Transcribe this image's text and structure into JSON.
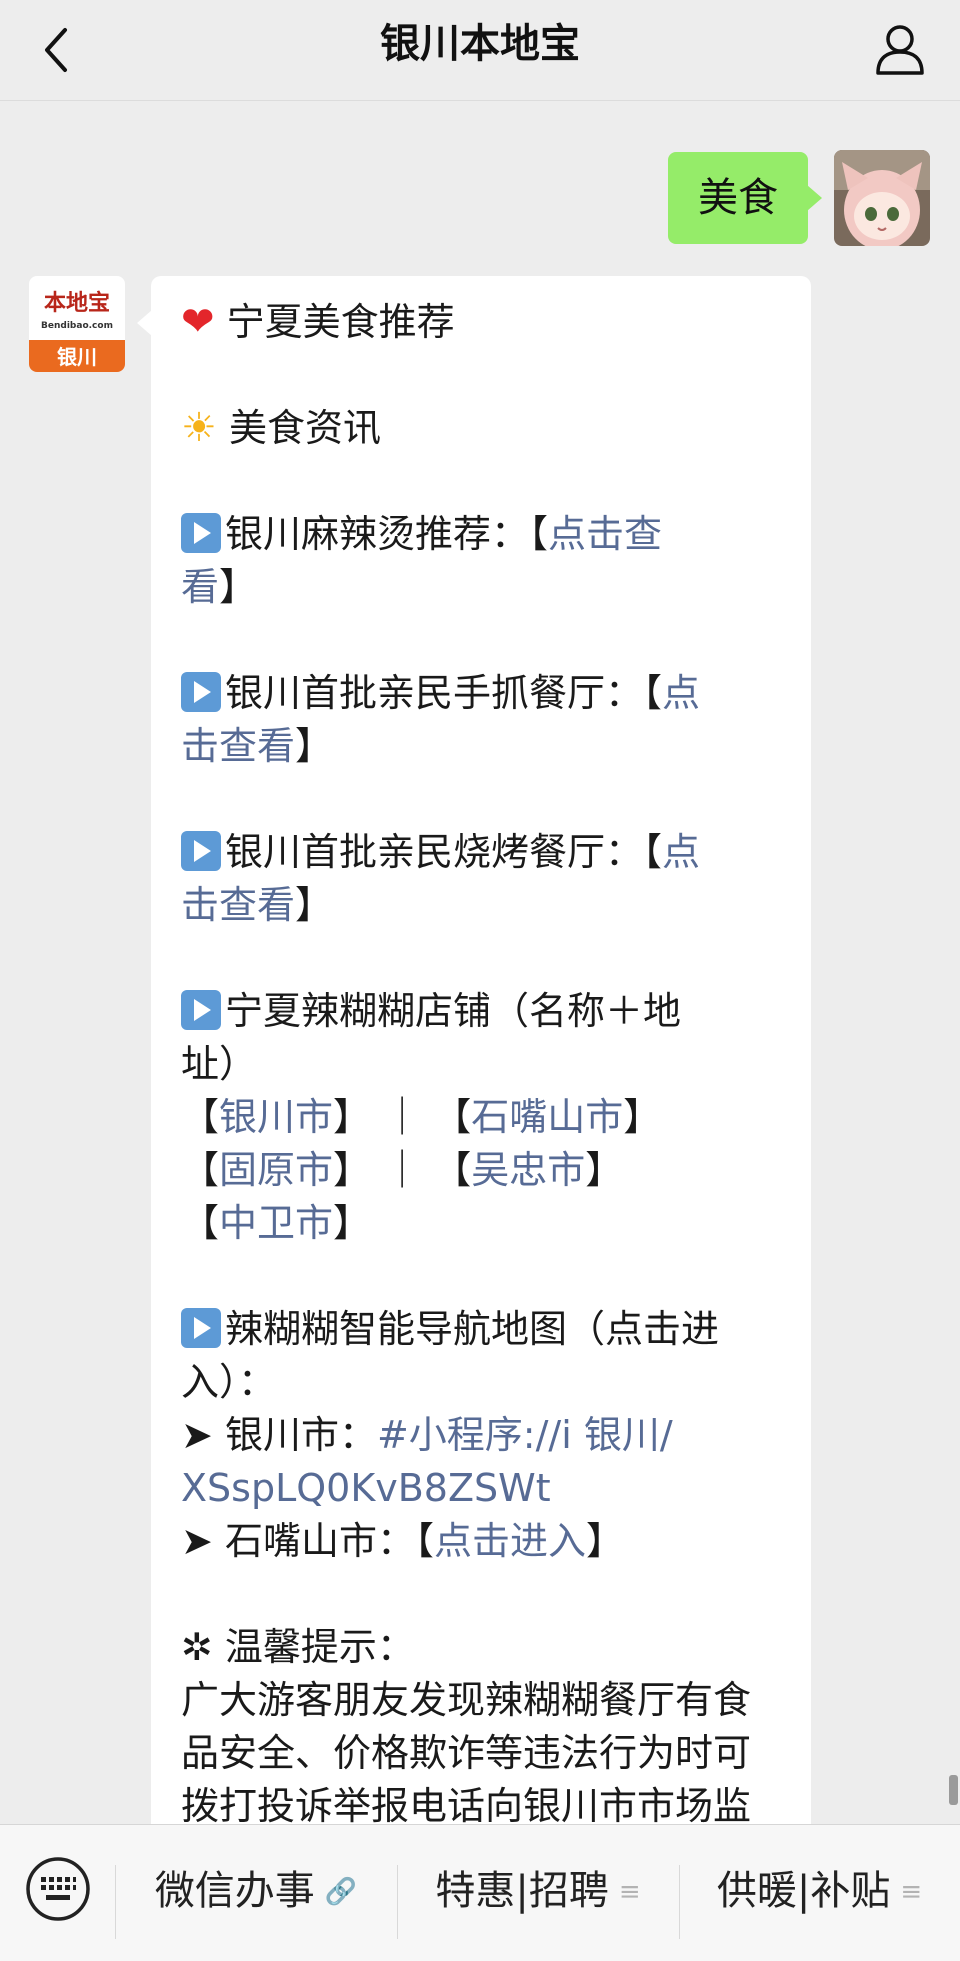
{
  "header": {
    "title": "银川本地宝"
  },
  "chat": {
    "outgoing_text": "美食",
    "bot_avatar": {
      "brand": "本地宝",
      "domain": "Bendibao.com",
      "city": "银川"
    },
    "message": {
      "heading": "宁夏美食推荐",
      "section": "美食资讯",
      "item1_text": "银川麻辣烫推荐：【",
      "item1_link_a": "点击查",
      "item1_link_b": "看",
      "item2_text": "银川首批亲民手抓餐厅：【",
      "item2_link_a": "点",
      "item2_link_b": "击查看",
      "item3_text": "银川首批亲民烧烤餐厅：【",
      "item3_link_a": "点",
      "item3_link_b": "击查看",
      "item4_text_a": "宁夏辣糊糊店铺（名称＋地",
      "item4_text_b": "址）",
      "city_yinchuan": "银川市",
      "city_shizuishan": "石嘴山市",
      "city_guyuan": "固原市",
      "city_wuzhong": "吴忠市",
      "city_zhongwei": "中卫市",
      "separator": "｜",
      "nav_text_a": "辣糊糊智能导航地图（点击进",
      "nav_text_b": "入）：",
      "arrow": "➤",
      "nav_yinchuan_label": "银川市：",
      "nav_yinchuan_link_a": "#小程序://i 银川/",
      "nav_yinchuan_link_b": "XSspLQ0KvB8ZSWt",
      "nav_szs_label": "石嘴山市：【",
      "nav_szs_link": "点击进入",
      "tip_title": "✲ 温馨提示：",
      "tip_line1": "广大游客朋友发现辣糊糊餐厅有食",
      "tip_line2": "品安全、价格欺诈等违法行为时可",
      "tip_line3": "拨打投诉举报电话向银川市市场监"
    }
  },
  "bottom_menu": {
    "items": [
      {
        "label": "微信办事",
        "icon": "link-icon"
      },
      {
        "label": "特惠|招聘",
        "icon": "menu-lines-icon"
      },
      {
        "label": "供暖|补贴",
        "icon": "menu-lines-icon"
      }
    ]
  }
}
